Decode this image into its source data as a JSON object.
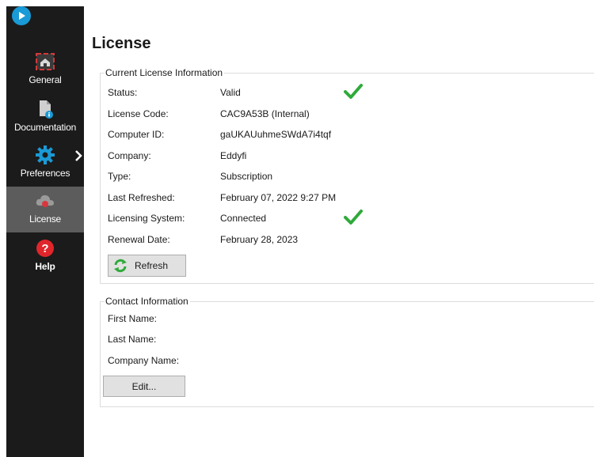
{
  "sidebar": {
    "logo_icon": "play-logo-icon",
    "items": [
      {
        "label": "General",
        "icon": "home-icon"
      },
      {
        "label": "Documentation",
        "icon": "document-icon"
      },
      {
        "label": "Preferences",
        "icon": "gear-icon"
      },
      {
        "label": "License",
        "icon": "cloud-license-icon",
        "active": true
      },
      {
        "label": "Help",
        "icon": "help-icon"
      }
    ]
  },
  "page": {
    "title": "License"
  },
  "license_info": {
    "legend": "Current License Information",
    "rows": [
      {
        "label": "Status:",
        "value": "Valid",
        "check": true
      },
      {
        "label": "License Code:",
        "value": "CAC9A53B (Internal)"
      },
      {
        "label": "Computer ID:",
        "value": "gaUKAUuhmeSWdA7i4tqf"
      },
      {
        "label": "Company:",
        "value": "Eddyfi"
      },
      {
        "label": "Type:",
        "value": "Subscription"
      },
      {
        "label": "Last Refreshed:",
        "value": "February 07, 2022 9:27 PM"
      },
      {
        "label": "Licensing System:",
        "value": "Connected",
        "check": true
      },
      {
        "label": "Renewal Date:",
        "value": "February 28, 2023"
      }
    ],
    "refresh_label": "Refresh"
  },
  "contact_info": {
    "legend": "Contact Information",
    "rows": [
      {
        "label": "First Name:"
      },
      {
        "label": "Last Name:"
      },
      {
        "label": "Company Name:"
      }
    ],
    "edit_label": "Edit..."
  },
  "colors": {
    "sidebar_bg": "#1b1b1b",
    "active_bg": "#5c5c5c",
    "accent_blue": "#1a9ad6",
    "check_green": "#2faa3a",
    "help_red": "#e0262b",
    "home_red": "#d23a3a"
  }
}
